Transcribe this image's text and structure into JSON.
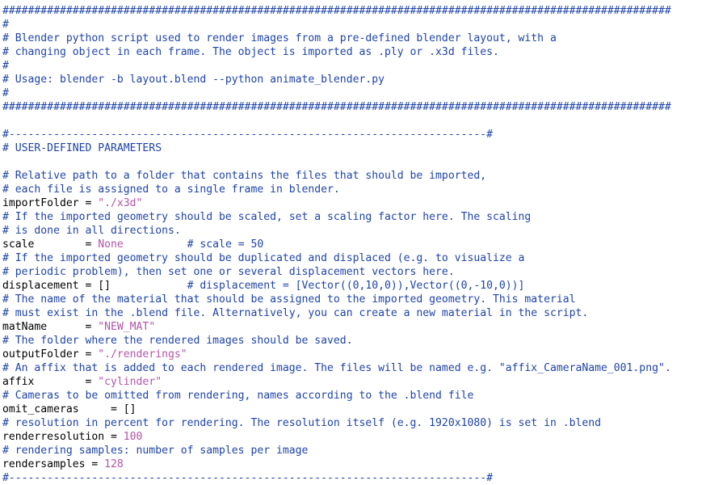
{
  "colors": {
    "background": "#ffffff",
    "comment": "#1f44a8",
    "string_literal": "#b254a8",
    "number_literal": "#b254a8",
    "code": "#000000"
  },
  "lines": [
    [
      {
        "t": "comment",
        "v": "#########################################################################################################"
      }
    ],
    [
      {
        "t": "comment",
        "v": "#"
      }
    ],
    [
      {
        "t": "comment",
        "v": "# Blender python script used to render images from a pre-defined blender layout, with a"
      }
    ],
    [
      {
        "t": "comment",
        "v": "# changing object in each frame. The object is imported as .ply or .x3d files."
      }
    ],
    [
      {
        "t": "comment",
        "v": "#"
      }
    ],
    [
      {
        "t": "comment",
        "v": "# Usage: blender -b layout.blend --python animate_blender.py"
      }
    ],
    [
      {
        "t": "comment",
        "v": "#"
      }
    ],
    [
      {
        "t": "comment",
        "v": "#########################################################################################################"
      }
    ],
    [
      {
        "t": "plain",
        "v": ""
      }
    ],
    [
      {
        "t": "comment",
        "v": "#---------------------------------------------------------------------------#"
      }
    ],
    [
      {
        "t": "comment",
        "v": "# USER-DEFINED PARAMETERS"
      }
    ],
    [
      {
        "t": "plain",
        "v": ""
      }
    ],
    [
      {
        "t": "comment",
        "v": "# Relative path to a folder that contains the files that should be imported,"
      }
    ],
    [
      {
        "t": "comment",
        "v": "# each file is assigned to a single frame in blender."
      }
    ],
    [
      {
        "t": "plain",
        "v": "importFolder = "
      },
      {
        "t": "str",
        "v": "\"./x3d\""
      }
    ],
    [
      {
        "t": "comment",
        "v": "# If the imported geometry should be scaled, set a scaling factor here. The scaling"
      }
    ],
    [
      {
        "t": "comment",
        "v": "# is done in all directions."
      }
    ],
    [
      {
        "t": "plain",
        "v": "scale        = "
      },
      {
        "t": "kw",
        "v": "None"
      },
      {
        "t": "plain",
        "v": "          "
      },
      {
        "t": "comment",
        "v": "# scale = 50"
      }
    ],
    [
      {
        "t": "comment",
        "v": "# If the imported geometry should be duplicated and displaced (e.g. to visualize a"
      }
    ],
    [
      {
        "t": "comment",
        "v": "# periodic problem), then set one or several displacement vectors here."
      }
    ],
    [
      {
        "t": "plain",
        "v": "displacement = []            "
      },
      {
        "t": "comment",
        "v": "# displacement = [Vector((0,10,0)),Vector((0,-10,0))]"
      }
    ],
    [
      {
        "t": "comment",
        "v": "# The name of the material that should be assigned to the imported geometry. This material"
      }
    ],
    [
      {
        "t": "comment",
        "v": "# must exist in the .blend file. Alternatively, you can create a new material in the script."
      }
    ],
    [
      {
        "t": "plain",
        "v": "matName      = "
      },
      {
        "t": "str",
        "v": "\"NEW_MAT\""
      }
    ],
    [
      {
        "t": "comment",
        "v": "# The folder where the rendered images should be saved."
      }
    ],
    [
      {
        "t": "plain",
        "v": "outputFolder = "
      },
      {
        "t": "str",
        "v": "\"./renderings\""
      }
    ],
    [
      {
        "t": "comment",
        "v": "# An affix that is added to each rendered image. The files will be named e.g. \"affix_CameraName_001.png\"."
      }
    ],
    [
      {
        "t": "plain",
        "v": "affix        = "
      },
      {
        "t": "str",
        "v": "\"cylinder\""
      }
    ],
    [
      {
        "t": "comment",
        "v": "# Cameras to be omitted from rendering, names according to the .blend file"
      }
    ],
    [
      {
        "t": "plain",
        "v": "omit_cameras     = []"
      }
    ],
    [
      {
        "t": "comment",
        "v": "# resolution in percent for rendering. The resolution itself (e.g. 1920x1080) is set in .blend"
      }
    ],
    [
      {
        "t": "plain",
        "v": "renderresolution = "
      },
      {
        "t": "num",
        "v": "100"
      }
    ],
    [
      {
        "t": "comment",
        "v": "# rendering samples: number of samples per image"
      }
    ],
    [
      {
        "t": "plain",
        "v": "rendersamples = "
      },
      {
        "t": "num",
        "v": "128"
      }
    ],
    [
      {
        "t": "comment",
        "v": "#---------------------------------------------------------------------------#"
      }
    ]
  ]
}
